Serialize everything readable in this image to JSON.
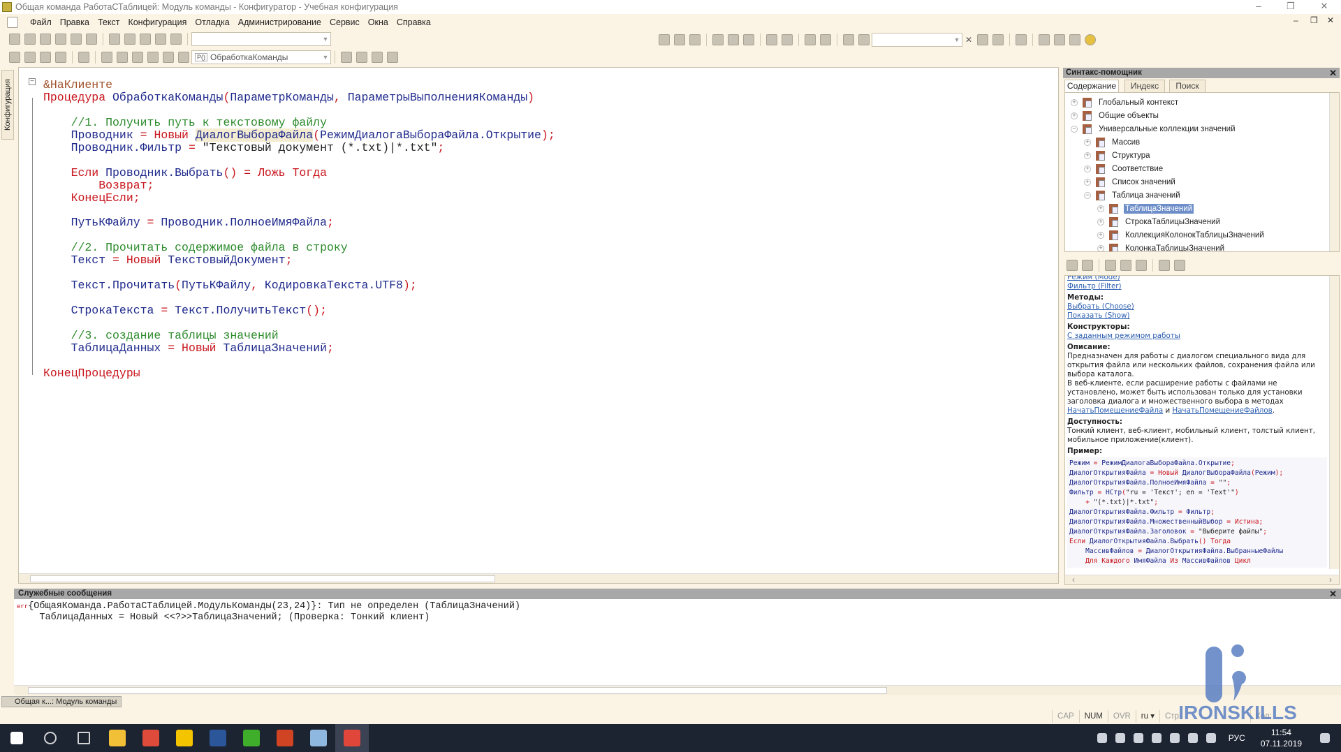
{
  "window": {
    "title": "Общая команда РаботаСТаблицей: Модуль команды - Конфигуратор - Учебная конфигурация",
    "min": "–",
    "restore": "❐",
    "close": "✕"
  },
  "menu": [
    "Файл",
    "Правка",
    "Текст",
    "Конфигурация",
    "Отладка",
    "Администрирование",
    "Сервис",
    "Окна",
    "Справка"
  ],
  "toolbar": {
    "module_combo": "ОбработкаКоманды",
    "module_combo_icon": "P()",
    "search_value": "",
    "method_combo": ""
  },
  "left_strip": {
    "label": "Конфигурация"
  },
  "editor": {
    "lines": [
      [
        [
          "&НаКлиенте",
          "pp"
        ]
      ],
      [
        [
          "Процедура ",
          "kw"
        ],
        [
          "ОбработкаКоманды",
          "id"
        ],
        [
          "(",
          "op"
        ],
        [
          "ПараметрКоманды",
          "id"
        ],
        [
          ", ",
          "op"
        ],
        [
          "ПараметрыВыполненияКоманды",
          "id"
        ],
        [
          ")",
          "op"
        ]
      ],
      [],
      [
        [
          "    //1. Получить путь к текстовому файлу",
          "cm"
        ]
      ],
      [
        [
          "    Проводник ",
          "id"
        ],
        [
          "= ",
          "op"
        ],
        [
          "Новый ",
          "kw"
        ],
        [
          "ДиалогВыбораФайла",
          "id hl"
        ],
        [
          "(",
          "op"
        ],
        [
          "РежимДиалогаВыбораФайла.Открытие",
          "id"
        ],
        [
          ");",
          "op"
        ]
      ],
      [
        [
          "    Проводник.Фильтр ",
          "id"
        ],
        [
          "= ",
          "op"
        ],
        [
          "\"Текстовый документ (*.txt)|*.txt\"",
          "st"
        ],
        [
          ";",
          "op"
        ]
      ],
      [],
      [
        [
          "    Если ",
          "kw"
        ],
        [
          "Проводник.Выбрать",
          "id"
        ],
        [
          "() = ",
          "op"
        ],
        [
          "Ложь ",
          "kw"
        ],
        [
          "Тогда",
          "kw"
        ]
      ],
      [
        [
          "        Возврат",
          "kw"
        ],
        [
          ";",
          "op"
        ]
      ],
      [
        [
          "    КонецЕсли",
          "kw"
        ],
        [
          ";",
          "op"
        ]
      ],
      [],
      [
        [
          "    ПутьКФайлу ",
          "id"
        ],
        [
          "= ",
          "op"
        ],
        [
          "Проводник.ПолноеИмяФайла",
          "id"
        ],
        [
          ";",
          "op"
        ]
      ],
      [],
      [
        [
          "    //2. Прочитать содержимое файла в строку",
          "cm"
        ]
      ],
      [
        [
          "    Текст ",
          "id"
        ],
        [
          "= ",
          "op"
        ],
        [
          "Новый ",
          "kw"
        ],
        [
          "ТекстовыйДокумент",
          "id"
        ],
        [
          ";",
          "op"
        ]
      ],
      [],
      [
        [
          "    Текст.Прочитать",
          "id"
        ],
        [
          "(",
          "op"
        ],
        [
          "ПутьКФайлу",
          "id"
        ],
        [
          ", ",
          "op"
        ],
        [
          "КодировкаТекста.UTF8",
          "id"
        ],
        [
          ");",
          "op"
        ]
      ],
      [],
      [
        [
          "    СтрокаТекста ",
          "id"
        ],
        [
          "= ",
          "op"
        ],
        [
          "Текст.ПолучитьТекст",
          "id"
        ],
        [
          "();",
          "op"
        ]
      ],
      [],
      [
        [
          "    //3. создание таблицы значений",
          "cm"
        ]
      ],
      [
        [
          "    ТаблицаДанных ",
          "id"
        ],
        [
          "= ",
          "op"
        ],
        [
          "Новый ",
          "kw"
        ],
        [
          "ТаблицаЗначений",
          "id"
        ],
        [
          ";",
          "op"
        ]
      ],
      [],
      [
        [
          "КонецПроцедуры",
          "kw"
        ]
      ]
    ]
  },
  "syntax_helper": {
    "title": "Синтакс-помощник",
    "tabs": [
      "Содержание",
      "Индекс",
      "Поиск"
    ],
    "tree": [
      {
        "label": "Глобальный контекст",
        "level": 0,
        "expanded": false
      },
      {
        "label": "Общие объекты",
        "level": 0,
        "expanded": false
      },
      {
        "label": "Универсальные коллекции значений",
        "level": 0,
        "expanded": true
      },
      {
        "label": "Массив",
        "level": 1,
        "expanded": false
      },
      {
        "label": "Структура",
        "level": 1,
        "expanded": false
      },
      {
        "label": "Соответствие",
        "level": 1,
        "expanded": false
      },
      {
        "label": "Список значений",
        "level": 1,
        "expanded": false
      },
      {
        "label": "Таблица значений",
        "level": 1,
        "expanded": true
      },
      {
        "label": "ТаблицаЗначений",
        "level": 2,
        "expanded": false,
        "selected": true
      },
      {
        "label": "СтрокаТаблицыЗначений",
        "level": 2,
        "expanded": false
      },
      {
        "label": "КоллекцияКолонокТаблицыЗначений",
        "level": 2,
        "expanded": false
      },
      {
        "label": "КолонкаТаблицыЗначений",
        "level": 2,
        "expanded": false
      }
    ],
    "help": {
      "prop_links": [
        "Режим (Mode)",
        "Фильтр (Filter)"
      ],
      "methods_title": "Методы:",
      "methods": [
        "Выбрать (Choose)",
        "Показать (Show)"
      ],
      "constructors_title": "Конструкторы:",
      "constructors": [
        "С заданным режимом работы"
      ],
      "description_title": "Описание:",
      "description_1": "Предназначен для работы с диалогом специального вида для открытия файла или нескольких файлов, сохранения файла или выбора каталога.",
      "description_2": "В веб-клиенте, если расширение работы с файлами не установлено, может быть использован только для установки заголовка диалога и множественного выбора в методах ",
      "description_link_1": "НачатьПомещениеФайла",
      "description_and": " и ",
      "description_link_2": "НачатьПомещениеФайлов",
      "description_end": ".",
      "availability_title": "Доступность:",
      "availability": "Тонкий клиент, веб-клиент, мобильный клиент, толстый клиент, мобильное приложение(клиент).",
      "example_title": "Пример:",
      "example": [
        [
          [
            "Режим ",
            "id"
          ],
          [
            "= ",
            "op"
          ],
          [
            "РежимДиалогаВыбораФайла.Открытие",
            "id"
          ],
          [
            ";",
            "op"
          ]
        ],
        [
          [
            "ДиалогОткрытияФайла ",
            "id"
          ],
          [
            "= ",
            "op"
          ],
          [
            "Новый ",
            "kw"
          ],
          [
            "ДиалогВыбораФайла",
            "id"
          ],
          [
            "(",
            "op"
          ],
          [
            "Режим",
            "id"
          ],
          [
            ");",
            "op"
          ]
        ],
        [
          [
            "ДиалогОткрытияФайла.ПолноеИмяФайла ",
            "id"
          ],
          [
            "= ",
            "op"
          ],
          [
            "\"\"",
            "st"
          ],
          [
            ";",
            "op"
          ]
        ],
        [
          [
            "Фильтр ",
            "id"
          ],
          [
            "= ",
            "op"
          ],
          [
            "НСтр",
            "id"
          ],
          [
            "(",
            "op"
          ],
          [
            "\"ru = 'Текст'; en = 'Text'\"",
            "st"
          ],
          [
            ")",
            "op"
          ]
        ],
        [
          [
            "    + ",
            "op"
          ],
          [
            "\"(*.txt)|*.txt\"",
            "st"
          ],
          [
            ";",
            "op"
          ]
        ],
        [
          [
            "ДиалогОткрытияФайла.Фильтр ",
            "id"
          ],
          [
            "= ",
            "op"
          ],
          [
            "Фильтр",
            "id"
          ],
          [
            ";",
            "op"
          ]
        ],
        [
          [
            "ДиалогОткрытияФайла.МножественныйВыбор ",
            "id"
          ],
          [
            "= ",
            "op"
          ],
          [
            "Истина",
            "kw"
          ],
          [
            ";",
            "op"
          ]
        ],
        [
          [
            "ДиалогОткрытияФайла.Заголовок ",
            "id"
          ],
          [
            "= ",
            "op"
          ],
          [
            "\"Выберите файлы\"",
            "st"
          ],
          [
            ";",
            "op"
          ]
        ],
        [
          [
            "Если ",
            "kw"
          ],
          [
            "ДиалогОткрытияФайла.Выбрать",
            "id"
          ],
          [
            "() ",
            "op"
          ],
          [
            "Тогда",
            "kw"
          ]
        ],
        [
          [
            "    МассивФайлов ",
            "id"
          ],
          [
            "= ",
            "op"
          ],
          [
            "ДиалогОткрытияФайла.ВыбранныеФайлы",
            "id"
          ]
        ],
        [
          [
            "    Для Каждого ",
            "kw"
          ],
          [
            "ИмяФайла ",
            "id"
          ],
          [
            "Из ",
            "kw"
          ],
          [
            "МассивФайлов ",
            "id"
          ],
          [
            "Цикл",
            "kw"
          ]
        ]
      ]
    }
  },
  "messages": {
    "title": "Служебные сообщения",
    "err_tag": "err",
    "line1": "{ОбщаяКоманда.РаботаСТаблицей.МодульКоманды(23,24)}: Тип не определен (ТаблицаЗначений)",
    "line2": "    ТаблицаДанных = Новый <<?>>ТаблицаЗначений; (Проверка: Тонкий клиент)"
  },
  "window_tabs": [
    "Общая к...: Модуль команды"
  ],
  "status": {
    "cap": "CAP",
    "num": "NUM",
    "ovr": "OVR",
    "lang": "ru ▾",
    "row": "Стр:",
    "col": "Кол:"
  },
  "taskbar": {
    "apps": [
      "windows-start",
      "search",
      "task-view",
      "file-explorer",
      "chrome",
      "1c-enterprise",
      "word",
      "green-app",
      "powerpoint",
      "notepad-pen",
      "1c-configurator"
    ],
    "app_colors": [
      "#ffffff",
      "#ffffff",
      "#ffffff",
      "#f2c037",
      "#de4b3a",
      "#f5c400",
      "#2b579a",
      "#3fae2a",
      "#d04423",
      "#8fb8e0",
      "#e0463a"
    ],
    "lang": "РУС",
    "time": "11:54",
    "date": "07.11.2019"
  },
  "watermark": {
    "text": "IRONSKILLS",
    "color": "#5b7fc4"
  }
}
